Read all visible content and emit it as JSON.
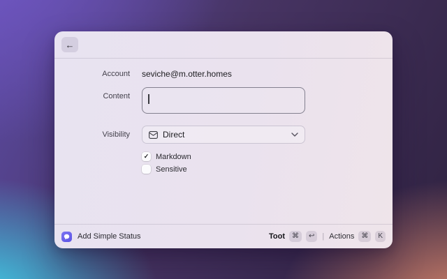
{
  "icons": {
    "back": "←",
    "command": "⌘",
    "return": "↩",
    "check": "✓",
    "pipe": "|"
  },
  "colors": {
    "logo": "#6158e7",
    "window_bg": "#e9e2ef",
    "bg_top_left": "#6b51b3",
    "bg_top_right": "#2f2240",
    "bg_bottom_left": "#3cc7e0",
    "bg_bottom_right": "#cd7767"
  },
  "window": {
    "form": {
      "account": {
        "label": "Account",
        "value": "seviche@m.otter.homes"
      },
      "content": {
        "label": "Content",
        "value": ""
      },
      "visibility": {
        "label": "Visibility",
        "selected": "Direct"
      },
      "checkboxes": [
        {
          "label": "Markdown",
          "checked": true
        },
        {
          "label": "Sensitive",
          "checked": false
        }
      ]
    },
    "footer": {
      "status_label": "Add Simple Status",
      "primary_action": {
        "label": "Toot",
        "keys": [
          "⌘",
          "↩"
        ]
      },
      "secondary_action": {
        "label": "Actions",
        "keys": [
          "⌘",
          "K"
        ]
      }
    }
  }
}
